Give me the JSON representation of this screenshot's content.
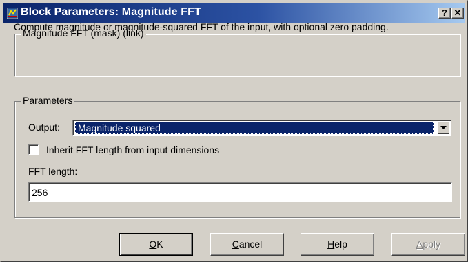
{
  "window": {
    "title": "Block Parameters: Magnitude FFT",
    "help_glyph": "?",
    "close_glyph": "✕"
  },
  "description": {
    "group_label": "Magnitude FFT (mask) (link)",
    "text": "Compute magnitude or magnitude-squared FFT of the input, with optional zero padding."
  },
  "parameters": {
    "group_label": "Parameters",
    "output_label": "Output:",
    "output_value": "Magnitude squared",
    "inherit_label": "Inherit FFT length from input dimensions",
    "inherit_checked": false,
    "fft_length_label": "FFT length:",
    "fft_length_value": "256"
  },
  "buttons": {
    "ok": {
      "mnemonic": "O",
      "rest": "K"
    },
    "cancel": {
      "mnemonic": "C",
      "rest": "ancel"
    },
    "help": {
      "mnemonic": "H",
      "rest": "elp"
    },
    "apply": {
      "mnemonic": "A",
      "rest": "pply"
    }
  },
  "icons": {
    "app": "simulink-block-icon",
    "dropdown": "chevron-down-icon"
  },
  "colors": {
    "title_gradient_start": "#0a246a",
    "title_gradient_end": "#a6caf0",
    "selection": "#0a246a",
    "face": "#d4d0c8"
  }
}
